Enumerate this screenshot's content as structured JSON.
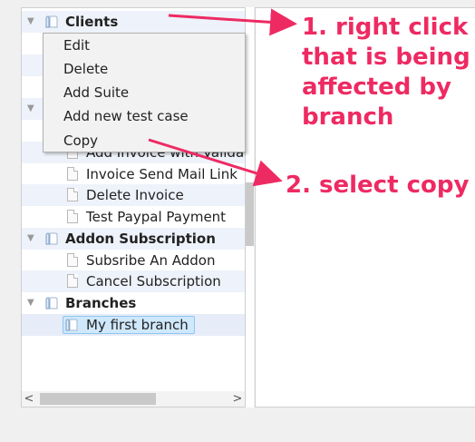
{
  "tree": {
    "rows": [
      {
        "label": "Clients",
        "type": "folder",
        "bold": true
      },
      {
        "label": "Add Invoice with Valida",
        "type": "file"
      },
      {
        "label": "Invoice Send Mail Link",
        "type": "file"
      },
      {
        "label": "Delete Invoice",
        "type": "file"
      },
      {
        "label": "Test Paypal Payment",
        "type": "file"
      },
      {
        "label": "Addon Subscription",
        "type": "folder",
        "bold": true
      },
      {
        "label": "Subsribe An Addon",
        "type": "file"
      },
      {
        "label": "Cancel Subscription",
        "type": "file"
      },
      {
        "label": "Branches",
        "type": "folder",
        "bold": true
      },
      {
        "label": "My first branch",
        "type": "branch",
        "selected": true
      }
    ]
  },
  "context_menu": {
    "items": [
      "Edit",
      "Delete",
      "Add Suite",
      "Add new test case",
      "Copy"
    ]
  },
  "annotations": {
    "step1_lines": [
      "1. right click",
      "that is being",
      "affected by",
      "branch"
    ],
    "step2": "2. select copy",
    "color": "#ee2a62"
  },
  "scrollbar": {
    "left_arrow": "<",
    "right_arrow": ">"
  }
}
